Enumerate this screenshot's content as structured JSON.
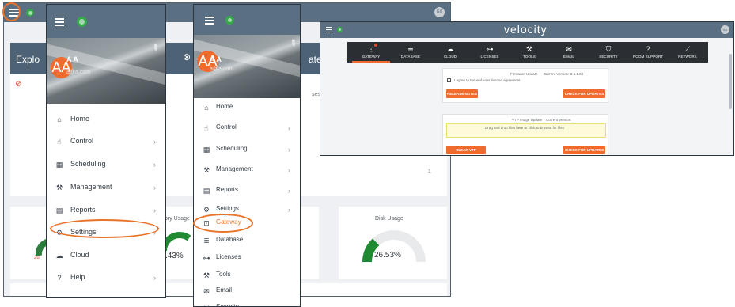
{
  "colors": {
    "accent": "#e8732a",
    "topbar": "#5b6f82",
    "green": "#35a94a",
    "nav": "#2b2f34",
    "orange": "#ef6c2e"
  },
  "background_app": {
    "partial_title_left": "Explo",
    "partial_title_right": "atew",
    "partial_text_ses": "ses",
    "page_number": "1",
    "memory_label_partial": "ory Usage",
    "memory_value_partial": ".43%",
    "disk_usage_label": "Disk Usage",
    "disk_usage_value": "26.53%",
    "disk_usage_fraction": 0.2653,
    "left_badge_partial": "2u",
    "user_initials": "GU"
  },
  "menu1": {
    "avatar_initials": "AA",
    "user_name": "A A",
    "user_email": "a@a.com",
    "items": [
      {
        "label": "Home",
        "icon": "home-icon",
        "chevron": false
      },
      {
        "label": "Control",
        "icon": "hand-pointer-icon",
        "chevron": true
      },
      {
        "label": "Scheduling",
        "icon": "calendar-icon",
        "chevron": true
      },
      {
        "label": "Management",
        "icon": "wrench-icon",
        "chevron": true
      },
      {
        "label": "Reports",
        "icon": "report-icon",
        "chevron": true
      },
      {
        "label": "Settings",
        "icon": "gear-icon",
        "chevron": true
      },
      {
        "label": "Cloud",
        "icon": "cloud-icon",
        "chevron": false
      },
      {
        "label": "Help",
        "icon": "help-icon",
        "chevron": true
      }
    ]
  },
  "menu2": {
    "avatar_initials": "AA",
    "user_name": "A A",
    "user_email": "a@a.com",
    "items": [
      {
        "label": "Home",
        "icon": "home-icon",
        "chevron": false
      },
      {
        "label": "Control",
        "icon": "hand-pointer-icon",
        "chevron": true
      },
      {
        "label": "Scheduling",
        "icon": "calendar-icon",
        "chevron": true
      },
      {
        "label": "Management",
        "icon": "wrench-icon",
        "chevron": true
      },
      {
        "label": "Reports",
        "icon": "report-icon",
        "chevron": true
      },
      {
        "label": "Settings",
        "icon": "gear-icon",
        "chevron": true
      }
    ],
    "sub_items": [
      {
        "label": "Gateway",
        "icon": "gateway-icon"
      },
      {
        "label": "Database",
        "icon": "database-icon"
      },
      {
        "label": "Licenses",
        "icon": "key-icon"
      },
      {
        "label": "Tools",
        "icon": "wrench-icon"
      },
      {
        "label": "Email",
        "icon": "email-icon"
      },
      {
        "label": "Security",
        "icon": "shield-icon"
      }
    ]
  },
  "velocity": {
    "logo": "velocity",
    "user_initials": "AA",
    "tabs": [
      {
        "label": "GATEWAY",
        "icon": "gateway-icon",
        "glyph": "⊡",
        "active": true
      },
      {
        "label": "DATABASE",
        "icon": "database-icon",
        "glyph": "≣",
        "active": false
      },
      {
        "label": "CLOUD",
        "icon": "cloud-icon",
        "glyph": "☁",
        "active": false
      },
      {
        "label": "LICENSES",
        "icon": "key-icon",
        "glyph": "⊶",
        "active": false
      },
      {
        "label": "TOOLS",
        "icon": "wrench-icon",
        "glyph": "⚒",
        "active": false
      },
      {
        "label": "EMAIL",
        "icon": "email-icon",
        "glyph": "✉",
        "active": false
      },
      {
        "label": "SECURITY",
        "icon": "shield-icon",
        "glyph": "⛉",
        "active": false
      },
      {
        "label": "ROOM SUPPORT",
        "icon": "help-icon",
        "glyph": "?",
        "active": false
      },
      {
        "label": "NETWORK",
        "icon": "network-icon",
        "glyph": "⟋",
        "active": false
      }
    ],
    "firmware": {
      "title": "Firmware Update",
      "current_version_label": "Current Version:",
      "current_version_value": "2.1.1.63",
      "agree_label": "I agree to the end-user license agreement",
      "release_notes_button": "RELEASE NOTES",
      "check_button": "CHECK FOR UPDATES"
    },
    "vtp": {
      "title": "VTP Image Update",
      "current_version_label": "Current Version:",
      "dropzone_text": "Drag and drop files here or click to browse for files",
      "clear_button": "CLEAR VTP FIRMWARE",
      "check_button": "CHECK FOR UPDATES"
    }
  }
}
